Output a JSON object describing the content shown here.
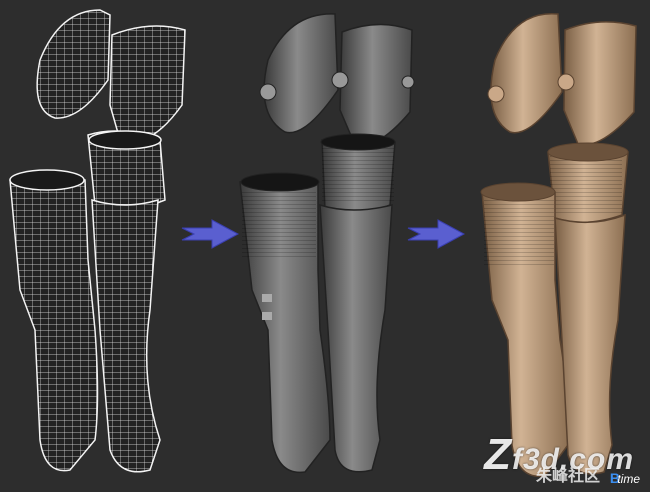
{
  "watermark": {
    "prefix": "Z",
    "site": "f3d.com",
    "chinese": "朱峰社区",
    "badge_b": "B",
    "badge_t": "time"
  },
  "colors": {
    "background": "#2d2d2d",
    "wire": "#f0f0f0",
    "grey_model": "#6e6e6e",
    "clay_model": "#b89878",
    "arrow": "#5a5fd0"
  },
  "stages": [
    "wireframe",
    "grey-shaded",
    "clay-textured"
  ]
}
